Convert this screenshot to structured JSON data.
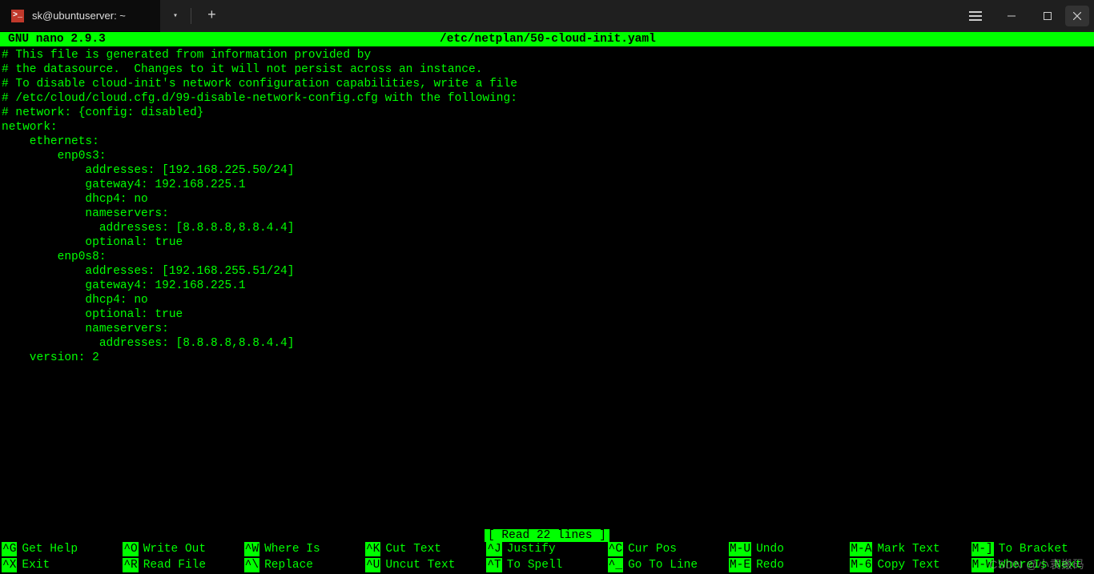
{
  "titlebar": {
    "tab_title": "sk@ubuntuserver: ~",
    "icon_glyph": ">_"
  },
  "nano": {
    "app": "GNU nano 2.9.3",
    "file": "/etc/netplan/50-cloud-init.yaml",
    "status": "[ Read 22 lines ]",
    "lines": [
      "",
      "# This file is generated from information provided by",
      "# the datasource.  Changes to it will not persist across an instance.",
      "# To disable cloud-init's network configuration capabilities, write a file",
      "# /etc/cloud/cloud.cfg.d/99-disable-network-config.cfg with the following:",
      "# network: {config: disabled}",
      "network:",
      "    ethernets:",
      "        enp0s3:",
      "            addresses: [192.168.225.50/24]",
      "            gateway4: 192.168.225.1",
      "            dhcp4: no",
      "            nameservers:",
      "              addresses: [8.8.8.8,8.8.4.4]",
      "            optional: true",
      "        enp0s8:",
      "            addresses: [192.168.255.51/24]",
      "            gateway4: 192.168.225.1",
      "            dhcp4: no",
      "            optional: true",
      "            nameservers:",
      "              addresses: [8.8.8.8,8.8.4.4]",
      "    version: 2"
    ]
  },
  "shortcuts": {
    "row1": [
      {
        "key": "^G",
        "desc": "Get Help"
      },
      {
        "key": "^O",
        "desc": "Write Out"
      },
      {
        "key": "^W",
        "desc": "Where Is"
      },
      {
        "key": "^K",
        "desc": "Cut Text"
      },
      {
        "key": "^J",
        "desc": "Justify"
      },
      {
        "key": "^C",
        "desc": "Cur Pos"
      },
      {
        "key": "M-U",
        "desc": "Undo"
      },
      {
        "key": "M-A",
        "desc": "Mark Text"
      },
      {
        "key": "M-]",
        "desc": "To Bracket"
      }
    ],
    "row2": [
      {
        "key": "^X",
        "desc": "Exit"
      },
      {
        "key": "^R",
        "desc": "Read File"
      },
      {
        "key": "^\\",
        "desc": "Replace"
      },
      {
        "key": "^U",
        "desc": "Uncut Text"
      },
      {
        "key": "^T",
        "desc": "To Spell"
      },
      {
        "key": "^_",
        "desc": "Go To Line"
      },
      {
        "key": "M-E",
        "desc": "Redo"
      },
      {
        "key": "M-6",
        "desc": "Copy Text"
      },
      {
        "key": "M-W",
        "desc": "WhereIs Next"
      }
    ]
  },
  "watermark": "CSDN @小袁搬码"
}
